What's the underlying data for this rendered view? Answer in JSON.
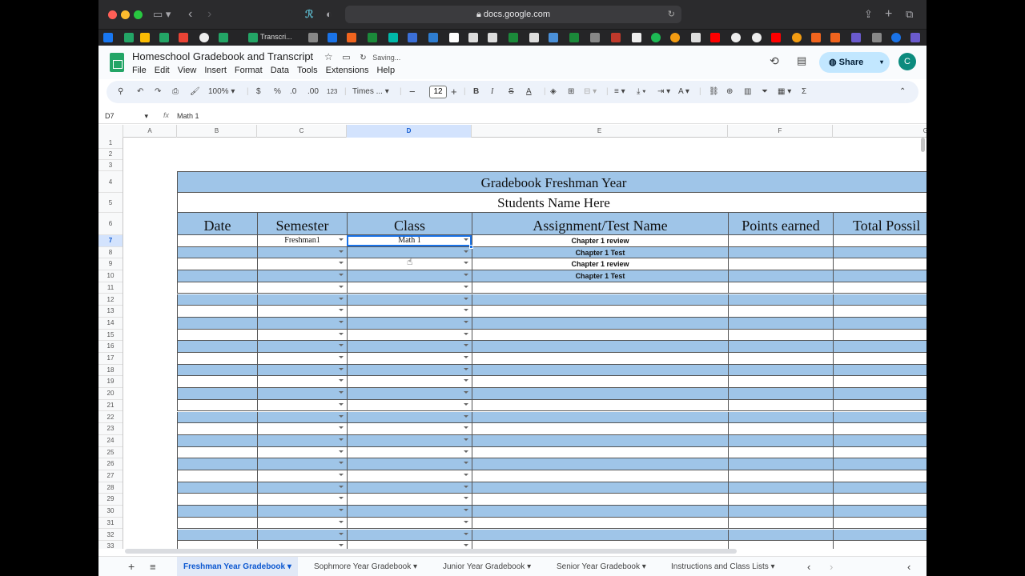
{
  "browser": {
    "url": "docs.google.com",
    "bookmark_label": "Transcri..."
  },
  "doc": {
    "title": "Homeschool Gradebook and Transcript",
    "status": "Saving...",
    "menus": [
      "File",
      "Edit",
      "View",
      "Insert",
      "Format",
      "Data",
      "Tools",
      "Extensions",
      "Help"
    ],
    "share_label": "Share",
    "avatar_initial": "C"
  },
  "toolbar": {
    "zoom": "100%",
    "currency": "$",
    "percent": "%",
    "dec_decrease": ".0",
    "dec_increase": ".00",
    "format_123": "123",
    "font": "Times ...",
    "font_size": "12",
    "bold": "B",
    "italic": "I",
    "strike": "S",
    "text_color": "A",
    "sum": "Σ"
  },
  "formula_bar": {
    "cell_ref": "D7",
    "fx": "fx",
    "value": "Math 1"
  },
  "columns": [
    "A",
    "B",
    "C",
    "D",
    "E",
    "F",
    "G"
  ],
  "rows": [
    "1",
    "2",
    "3",
    "4",
    "5",
    "6",
    "7",
    "8",
    "9",
    "10",
    "11",
    "12",
    "13",
    "14",
    "15",
    "16",
    "17",
    "18",
    "19",
    "20",
    "21",
    "22",
    "23",
    "24",
    "25",
    "26",
    "27",
    "28",
    "29",
    "30",
    "31",
    "32",
    "33"
  ],
  "sheet": {
    "title": "Gradebook Freshman Year",
    "subtitle": "Students Name Here",
    "headers": [
      "Date",
      "Semester",
      "Class",
      "Assignment/Test Name",
      "Points earned",
      "Total Possil"
    ],
    "data_rows": [
      {
        "semester": "Freshman1",
        "class": "Math 1",
        "assignment": "Chapter 1 review"
      },
      {
        "semester": "",
        "class": "",
        "assignment": "Chapter 1 Test"
      },
      {
        "semester": "",
        "class": "",
        "assignment": "Chapter 1 review"
      },
      {
        "semester": "",
        "class": "",
        "assignment": "Chapter 1 Test"
      }
    ]
  },
  "tabs": [
    "Freshman Year Gradebook",
    "Sophmore Year Gradebook",
    "Junior Year Gradebook",
    "Senior Year Gradebook",
    "Instructions and Class Lists"
  ],
  "colors": {
    "band_blue": "#9fc5e8",
    "sheets_green": "#23a566",
    "selection": "#1a73e8"
  }
}
